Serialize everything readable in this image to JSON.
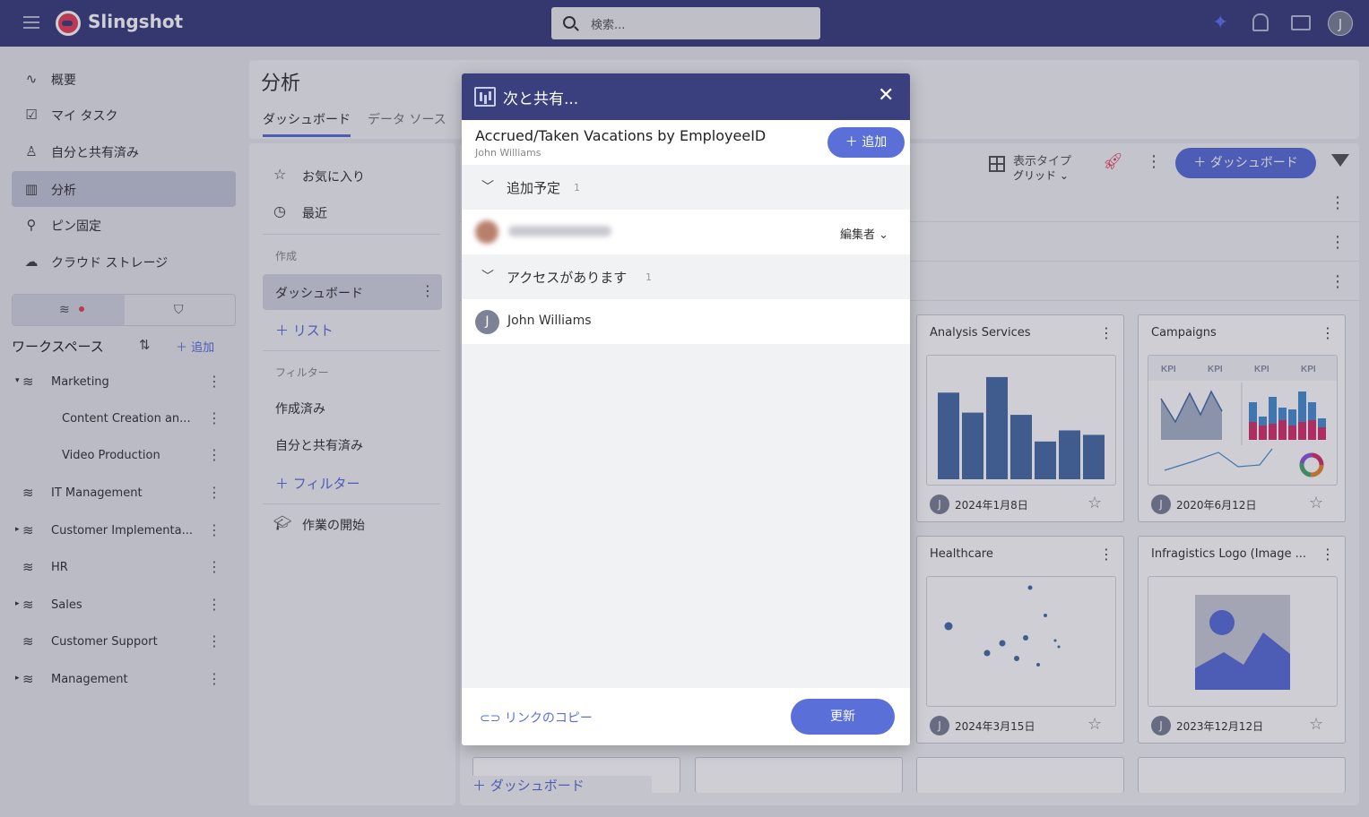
{
  "app": {
    "name": "Slingshot",
    "search_placeholder": "検索...",
    "user_initial": "J"
  },
  "nav": {
    "items": [
      {
        "label": "概要",
        "icon": "activity-icon"
      },
      {
        "label": "マイ タスク",
        "icon": "clipboard-icon"
      },
      {
        "label": "自分と共有済み",
        "icon": "shared-user-icon"
      },
      {
        "label": "分析",
        "icon": "bar-chart-icon"
      },
      {
        "label": "ピン固定",
        "icon": "pin-icon"
      },
      {
        "label": "クラウド ストレージ",
        "icon": "cloud-icon"
      }
    ]
  },
  "workspaces": {
    "title": "ワークスペース",
    "add_label": "追加",
    "items": [
      {
        "label": "Marketing",
        "expanded": true
      },
      {
        "label": "Content Creation an...",
        "child": true
      },
      {
        "label": "Video Production",
        "child": true
      },
      {
        "label": "IT Management"
      },
      {
        "label": "Customer Implementa..."
      },
      {
        "label": "HR"
      },
      {
        "label": "Sales"
      },
      {
        "label": "Customer Support"
      },
      {
        "label": "Management"
      }
    ]
  },
  "main": {
    "title": "分析",
    "tabs": [
      "ダッシュボード",
      "データ ソース"
    ]
  },
  "filters": {
    "favorites": "お気に入り",
    "recent": "最近",
    "create_section": "作成",
    "dashboards": "ダッシュボード",
    "add_list": "リスト",
    "filter_section": "フィルター",
    "created": "作成済み",
    "shared_with_me": "自分と共有済み",
    "add_filter": "フィルター",
    "get_started": "作業の開始"
  },
  "toolbar": {
    "view_type_label": "表示タイプ",
    "view_type_value": "グリッド",
    "add_dashboard": "ダッシュボード"
  },
  "cards": [
    {
      "title": "Analysis Services",
      "date": "2024年1月8日",
      "owner": "J",
      "kind": "bar",
      "bars": [
        0.78,
        0.6,
        0.92,
        0.58,
        0.34,
        0.44,
        0.4
      ]
    },
    {
      "title": "Campaigns",
      "date": "2020年6月12日",
      "owner": "J",
      "kind": "kpi",
      "kpi_label": "KPI"
    },
    {
      "title": "Healthcare",
      "date": "2024年3月15日",
      "owner": "J",
      "kind": "scatter"
    },
    {
      "title": "Infragistics Logo (Image ...",
      "date": "2023年12月12日",
      "owner": "J",
      "kind": "image"
    }
  ],
  "bottom": {
    "add_dashboard": "ダッシュボード"
  },
  "dialog": {
    "title": "次と共有...",
    "dashboard_name": "Accrued/Taken Vacations by EmployeeID",
    "owner": "John Williams",
    "add_button": "追加",
    "pending_section": "追加予定",
    "pending_count": "1",
    "pending_role": "編集者",
    "access_section": "アクセスがあります",
    "access_count": "1",
    "access_user": "John Williams",
    "access_initial": "J",
    "copy_link": "リンクのコピー",
    "update_button": "更新"
  },
  "colors": {
    "brand": "#3a3f7e",
    "accent": "#5a6fd8",
    "chart_blue": "#4a6da7",
    "chart_pink": "#d6336c"
  }
}
